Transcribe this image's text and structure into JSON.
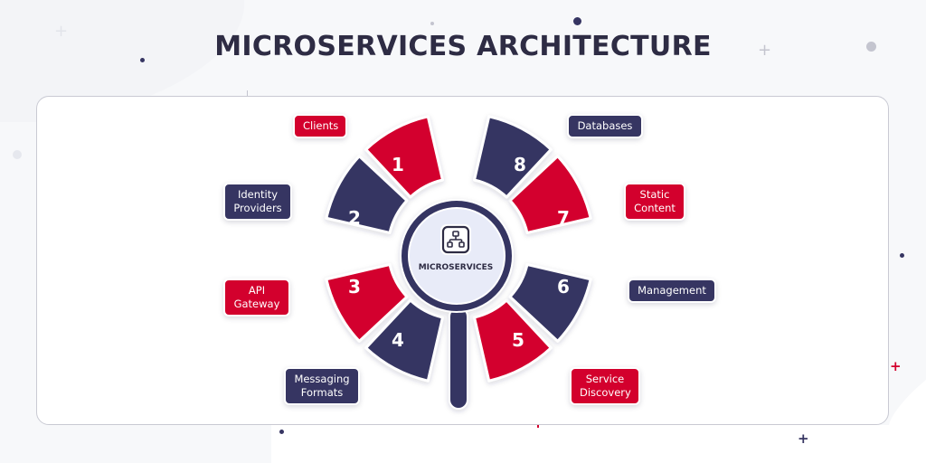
{
  "title": "MICROSERVICES ARCHITECTURE",
  "center": {
    "label": "MICROSERVICES",
    "icon": "hierarchy-icon"
  },
  "colors": {
    "red": "#d3002d",
    "navy": "#363562",
    "title": "#2e2c44",
    "center_fill": "#e8ebf8"
  },
  "segments": [
    {
      "number": "1",
      "label": "Clients",
      "color": "red"
    },
    {
      "number": "2",
      "label": "Identity Providers",
      "color": "navy"
    },
    {
      "number": "3",
      "label": "API Gateway",
      "color": "red"
    },
    {
      "number": "4",
      "label": "Messaging Formats",
      "color": "navy"
    },
    {
      "number": "5",
      "label": "Service Discovery",
      "color": "red"
    },
    {
      "number": "6",
      "label": "Management",
      "color": "navy"
    },
    {
      "number": "7",
      "label": "Static Content",
      "color": "red"
    },
    {
      "number": "8",
      "label": "Databases",
      "color": "navy"
    }
  ],
  "labels": {
    "l1": "Clients",
    "l2a": "Identity",
    "l2b": "Providers",
    "l3a": "API",
    "l3b": "Gateway",
    "l4a": "Messaging",
    "l4b": "Formats",
    "l5a": "Service",
    "l5b": "Discovery",
    "l6": "Management",
    "l7a": "Static",
    "l7b": "Content",
    "l8": "Databases"
  },
  "decorations": {
    "plus_glyph": "+"
  }
}
